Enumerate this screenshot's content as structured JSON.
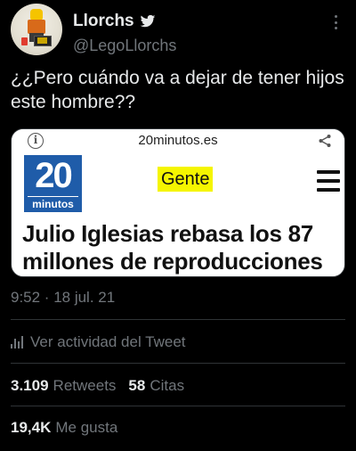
{
  "author": {
    "display_name": "Llorchs",
    "handle": "@LegoLlorchs"
  },
  "tweet": {
    "text": "¿¿Pero cuándo va a dejar de tener hijos este hombre??",
    "timestamp": "9:52 · 18 jul. 21"
  },
  "card": {
    "domain": "20minutos.es",
    "logo_number": "20",
    "logo_word": "minutos",
    "section": "Gente",
    "headline": "Julio Iglesias rebasa los 87 millones de reproducciones"
  },
  "actions": {
    "activity_label": "Ver actividad del Tweet"
  },
  "stats": {
    "retweets_count": "3.109",
    "retweets_label": "Retweets",
    "quotes_count": "58",
    "quotes_label": "Citas",
    "likes_count": "19,4K",
    "likes_label": "Me gusta"
  },
  "colors": {
    "background": "#000000",
    "text_primary": "#e7e9ea",
    "text_secondary": "#71767b",
    "logo_blue": "#1f5ca9",
    "section_yellow": "#f5f500"
  }
}
